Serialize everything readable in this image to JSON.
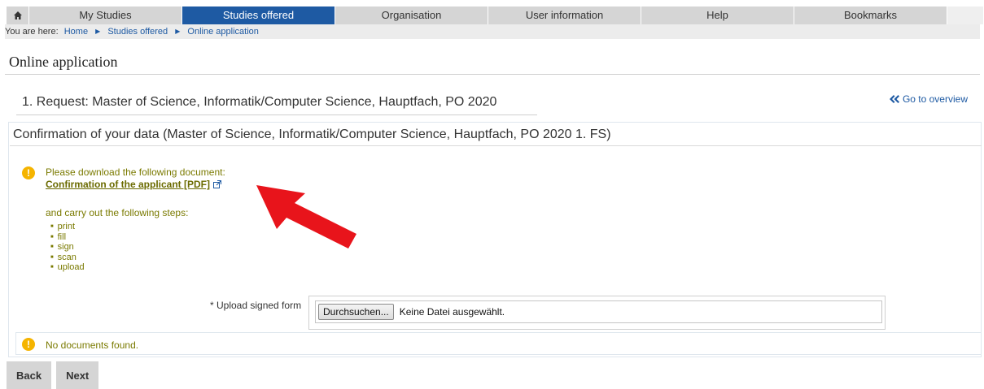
{
  "nav": {
    "tabs": [
      {
        "label": "My Studies"
      },
      {
        "label": "Studies offered"
      },
      {
        "label": "Organisation"
      },
      {
        "label": "User information"
      },
      {
        "label": "Help"
      },
      {
        "label": "Bookmarks"
      }
    ],
    "active_tab": "Studies offered",
    "home_icon": "home-icon"
  },
  "breadcrumb": {
    "prefix": "You are here:",
    "items": [
      "Home",
      "Studies offered",
      "Online application"
    ]
  },
  "page": {
    "title": "Online application",
    "request_title": "1. Request: Master of Science, Informatik/Computer Science, Hauptfach, PO 2020",
    "overview_link": "Go to overview"
  },
  "confirmation": {
    "title": "Confirmation of your data (Master of Science, Informatik/Computer Science, Hauptfach, PO 2020 1. FS)",
    "info_text": "Please download the following document:",
    "pdf_link": "Confirmation of the applicant [PDF]",
    "steps_intro": "and carry out the following steps:",
    "steps": [
      "print",
      "fill",
      "sign",
      "scan",
      "upload"
    ]
  },
  "upload": {
    "label": "* Upload signed form",
    "browse_button": "Durchsuchen...",
    "file_status": "Keine Datei ausgewählt."
  },
  "documents": {
    "empty_message": "No documents found."
  },
  "footer": {
    "back": "Back",
    "next": "Next"
  },
  "colors": {
    "accent": "#1e5aa3",
    "info_icon": "#f5b400",
    "info_text": "#7a7a00",
    "annotation_arrow": "#e8141b"
  }
}
